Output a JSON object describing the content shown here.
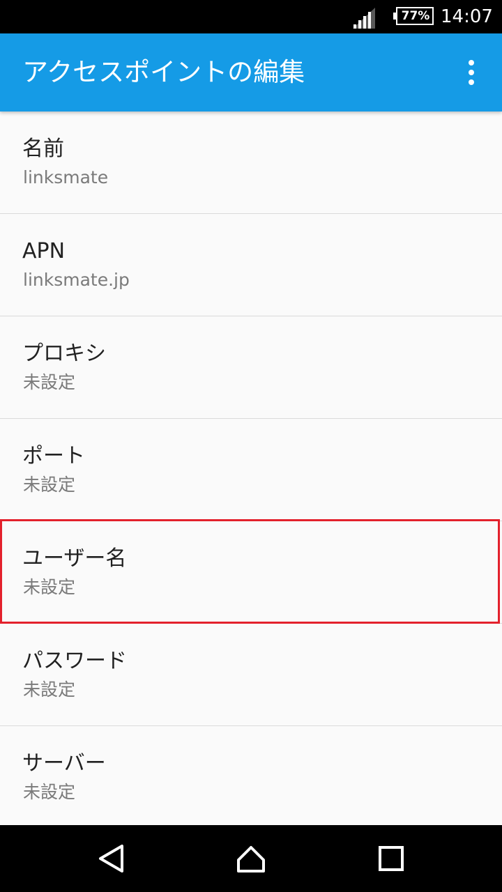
{
  "status_bar": {
    "battery": "77%",
    "time": "14:07",
    "icons": [
      "signal-icon",
      "battery-icon"
    ]
  },
  "app_bar": {
    "title": "アクセスポイントの編集",
    "menu_icon": "more-vert-icon"
  },
  "settings": [
    {
      "label": "名前",
      "value": "linksmate"
    },
    {
      "label": "APN",
      "value": "linksmate.jp"
    },
    {
      "label": "プロキシ",
      "value": "未設定"
    },
    {
      "label": "ポート",
      "value": "未設定"
    },
    {
      "label": "ユーザー名",
      "value": "未設定"
    },
    {
      "label": "パスワード",
      "value": "未設定"
    },
    {
      "label": "サーバー",
      "value": "未設定"
    }
  ],
  "highlighted_item": "ユーザー名",
  "highlight_color": "#e3212c",
  "app_bar_color": "#159be6",
  "nav_bar": {
    "icons": [
      "back-icon",
      "home-icon",
      "recents-icon"
    ]
  }
}
